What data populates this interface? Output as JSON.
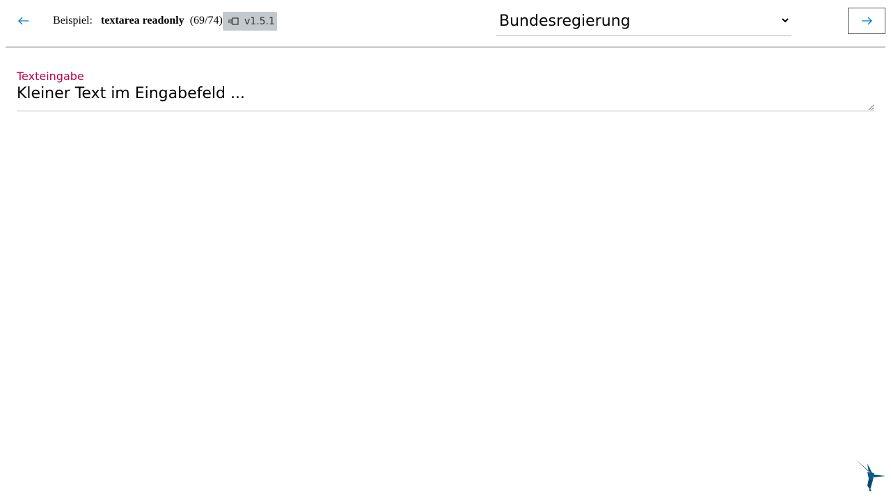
{
  "header": {
    "example_label": "Beispiel:",
    "example_name": "textarea readonly",
    "example_count": "(69/74)",
    "version": "v1.5.1",
    "theme_selected": "Bundesregierung"
  },
  "field": {
    "label": "Texteingabe",
    "value": "Kleiner Text im Eingabefeld ..."
  },
  "icons": {
    "prev": "arrow-left-icon",
    "next": "arrow-right-icon",
    "version": "copy-icon",
    "select": "chevron-down-icon",
    "logo": "hummingbird-logo"
  },
  "colors": {
    "accent": "#0077b6",
    "label": "#c0004e",
    "badge_bg": "#c3c9cd",
    "logo": "#004b76"
  }
}
